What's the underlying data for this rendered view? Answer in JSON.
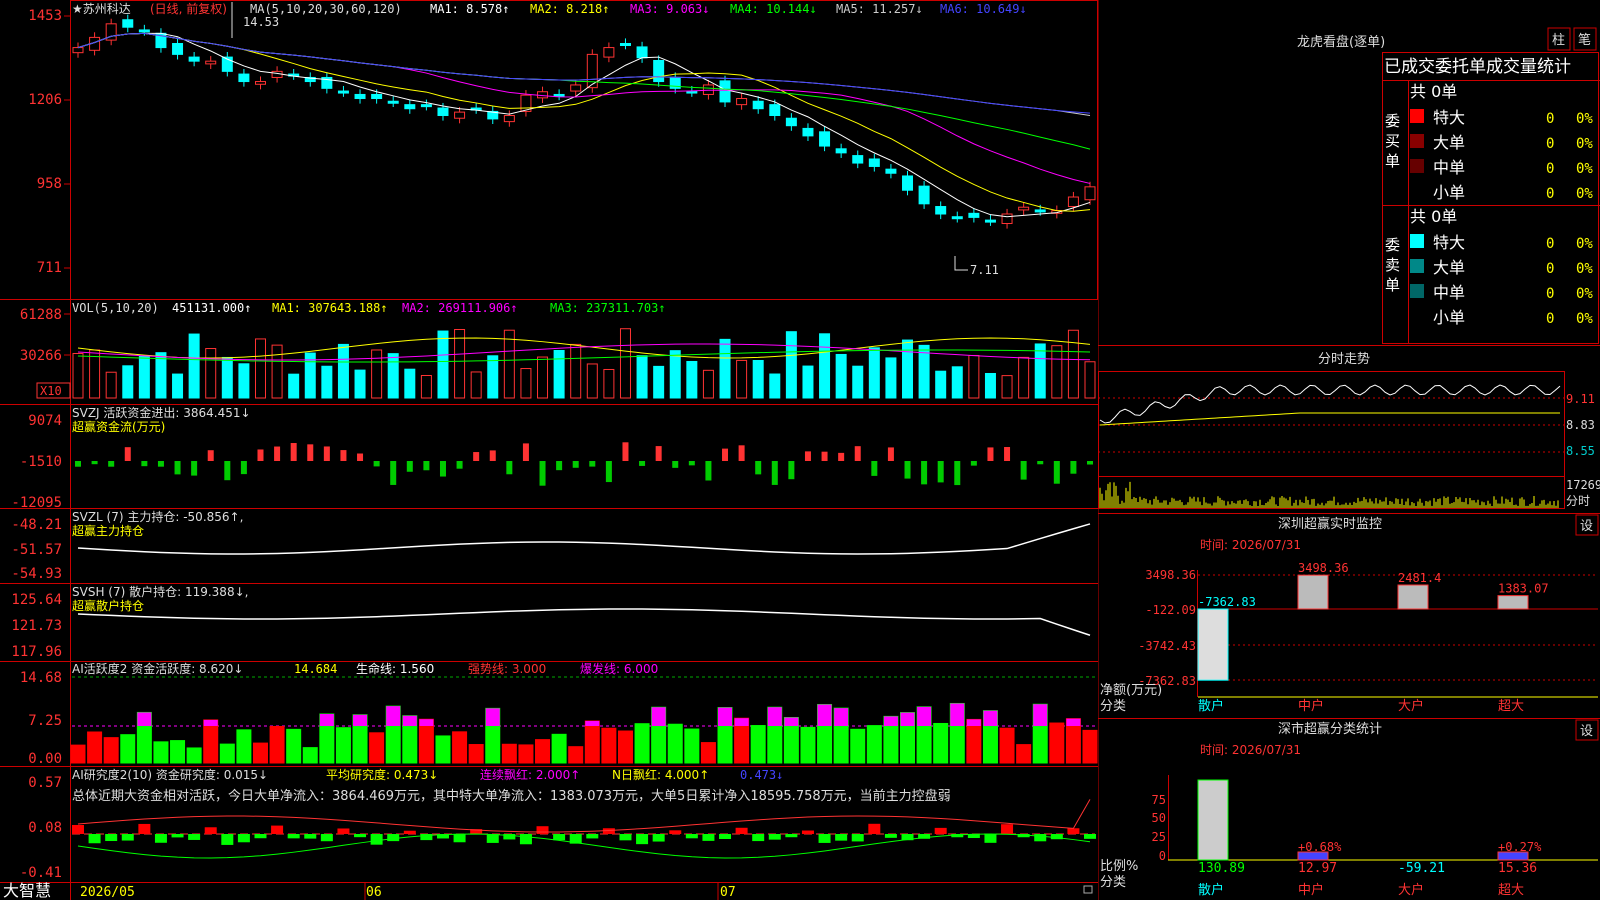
{
  "header": {
    "stock": "★苏州科达",
    "mode": "(日线, 前复权)",
    "ma_label": "MA(5,10,20,30,60,120)",
    "ma1": "MA1: 8.578↑",
    "ma2": "MA2: 8.218↑",
    "ma3": "MA3: 9.063↓",
    "ma4": "MA4: 10.144↓",
    "ma5": "MA5: 11.257↓",
    "ma6": "MA6: 10.649↓"
  },
  "price_axis": [
    "1453",
    "1206",
    "958",
    "711"
  ],
  "price_marks": {
    "high": "14.53",
    "low": "7.11"
  },
  "vol_panel": {
    "label": "VOL(5,10,20)",
    "val": "451131.000↑",
    "ma1": "MA1: 307643.188↑",
    "ma2": "MA2: 269111.906↑",
    "ma3": "MA3: 237311.703↑",
    "axis": [
      "61288",
      "30266"
    ],
    "unit": "X10"
  },
  "svzj_panel": {
    "label": "SVZJ  活跃资金进出: 3864.451↓",
    "sub": "超赢资金流(万元)",
    "axis": [
      "9074",
      "-1510",
      "-12095"
    ]
  },
  "svzl_panel": {
    "label": "SVZL (7) 主力持仓: -50.856↑,",
    "sub": "超赢主力持仓",
    "axis": [
      "-48.21",
      "-51.57",
      "-54.93"
    ]
  },
  "svsh_panel": {
    "label": "SVSH (7) 散户持仓: 119.388↓,",
    "sub": "超赢散户持仓",
    "axis": [
      "125.64",
      "121.73",
      "117.96"
    ]
  },
  "ai1_panel": {
    "label": "AI活跃度2 资金活跃度: 8.620↓",
    "v2": "14.684",
    "v3": "生命线: 1.560",
    "v4": "强势线: 3.000",
    "v5": "爆发线: 6.000",
    "axis": [
      "14.68",
      "7.25",
      "0.00"
    ]
  },
  "ai2_panel": {
    "label": "AI研究度2(10) 资金研究度: 0.015↓",
    "v2": "平均研究度: 0.473↓",
    "v3": "连续飘红: 2.000↑",
    "v4": "N日飘红: 4.000↑",
    "v5": "0.473↓",
    "summary": "总体近期大资金相对活跃，今日大单净流入：3864.469万元，其中特大单净流入：1383.073万元，大单5日累计净入18595.758万元，当前主力控盘弱",
    "axis": [
      "0.57",
      "0.08",
      "-0.41"
    ]
  },
  "date_axis": [
    "2026/05",
    "06",
    "07"
  ],
  "brand": "大智慧",
  "side": {
    "lhb_title": "龙虎看盘(逐单)",
    "btn_bar": "柱",
    "btn_line": "笔",
    "tabs": "已成交委托单成交量统计",
    "buy": {
      "group": "委买单",
      "total": "共 0单",
      "rows": [
        {
          "name": "特大",
          "count": "0",
          "pct": "0%"
        },
        {
          "name": "大单",
          "count": "0",
          "pct": "0%"
        },
        {
          "name": "中单",
          "count": "0",
          "pct": "0%"
        },
        {
          "name": "小单",
          "count": "0",
          "pct": "0%"
        }
      ]
    },
    "sell": {
      "group": "委卖单",
      "total": "共 0单",
      "rows": [
        {
          "name": "特大",
          "count": "0",
          "pct": "0%"
        },
        {
          "name": "大单",
          "count": "0",
          "pct": "0%"
        },
        {
          "name": "中单",
          "count": "0",
          "pct": "0%"
        },
        {
          "name": "小单",
          "count": "0",
          "pct": "0%"
        }
      ]
    },
    "intraday": {
      "title": "分时走势",
      "axis": [
        "9.11",
        "8.83",
        "8.55"
      ],
      "vol": "17269",
      "vol_label": "分时"
    },
    "monitor": {
      "title": "深圳超赢实时监控",
      "btn": "设",
      "time": "时间: 2026/07/31",
      "axis": [
        "3498.36",
        "-122.09",
        "-3742.43",
        "-7362.83"
      ],
      "unit1": "净额(万元)",
      "unit2": "分类",
      "bars": [
        {
          "cat": "散户",
          "value": "-7362.83"
        },
        {
          "cat": "中户",
          "value": "3498.36"
        },
        {
          "cat": "大户",
          "value": "2481.4"
        },
        {
          "cat": "超大",
          "value": "1383.07"
        }
      ]
    },
    "classify": {
      "title": "深市超赢分类统计",
      "btn": "设",
      "time": "时间: 2026/07/31",
      "axis": [
        "75",
        "50",
        "25",
        "0"
      ],
      "unit1": "比例%",
      "unit2": "分类",
      "bars": [
        {
          "cat": "散户",
          "value": "130.89",
          "pct": ""
        },
        {
          "cat": "中户",
          "value": "12.97",
          "pct": "+0.68%"
        },
        {
          "cat": "大户",
          "value": "-59.21",
          "pct": ""
        },
        {
          "cat": "超大",
          "value": "15.36",
          "pct": "+0.27%"
        }
      ]
    }
  },
  "chart_data": [
    {
      "type": "candlestick",
      "title": "苏州科达 (日线, 前复权)",
      "ylim": [
        7.11,
        14.53
      ],
      "x": [
        "2026/05",
        "06",
        "07"
      ],
      "series": [
        {
          "name": "price_close_approx",
          "values": [
            13.6,
            13.9,
            14.3,
            14.2,
            14.1,
            13.6,
            13.4,
            13.2,
            13.2,
            12.9,
            12.6,
            12.6,
            12.9,
            12.8,
            12.6,
            12.4,
            12.3,
            12.1,
            12.1,
            12.0,
            11.8,
            11.9,
            11.6,
            11.7,
            11.8,
            11.5,
            11.6,
            12.2,
            12.3,
            12.2,
            12.5,
            13.4,
            13.6,
            13.7,
            13.3,
            12.6,
            12.4,
            12.3,
            12.5,
            12.0,
            12.1,
            11.8,
            11.6,
            11.3,
            11.0,
            10.7,
            10.5,
            10.2,
            10.1,
            9.9,
            9.4,
            9.0,
            8.7,
            8.6,
            8.6,
            8.5,
            8.7,
            8.9,
            8.8,
            8.8,
            9.2,
            9.5
          ]
        }
      ]
    },
    {
      "type": "bar",
      "title": "VOL(5,10,20)",
      "series": [
        {
          "name": "VOL",
          "values": [
            451131
          ]
        }
      ]
    }
  ]
}
